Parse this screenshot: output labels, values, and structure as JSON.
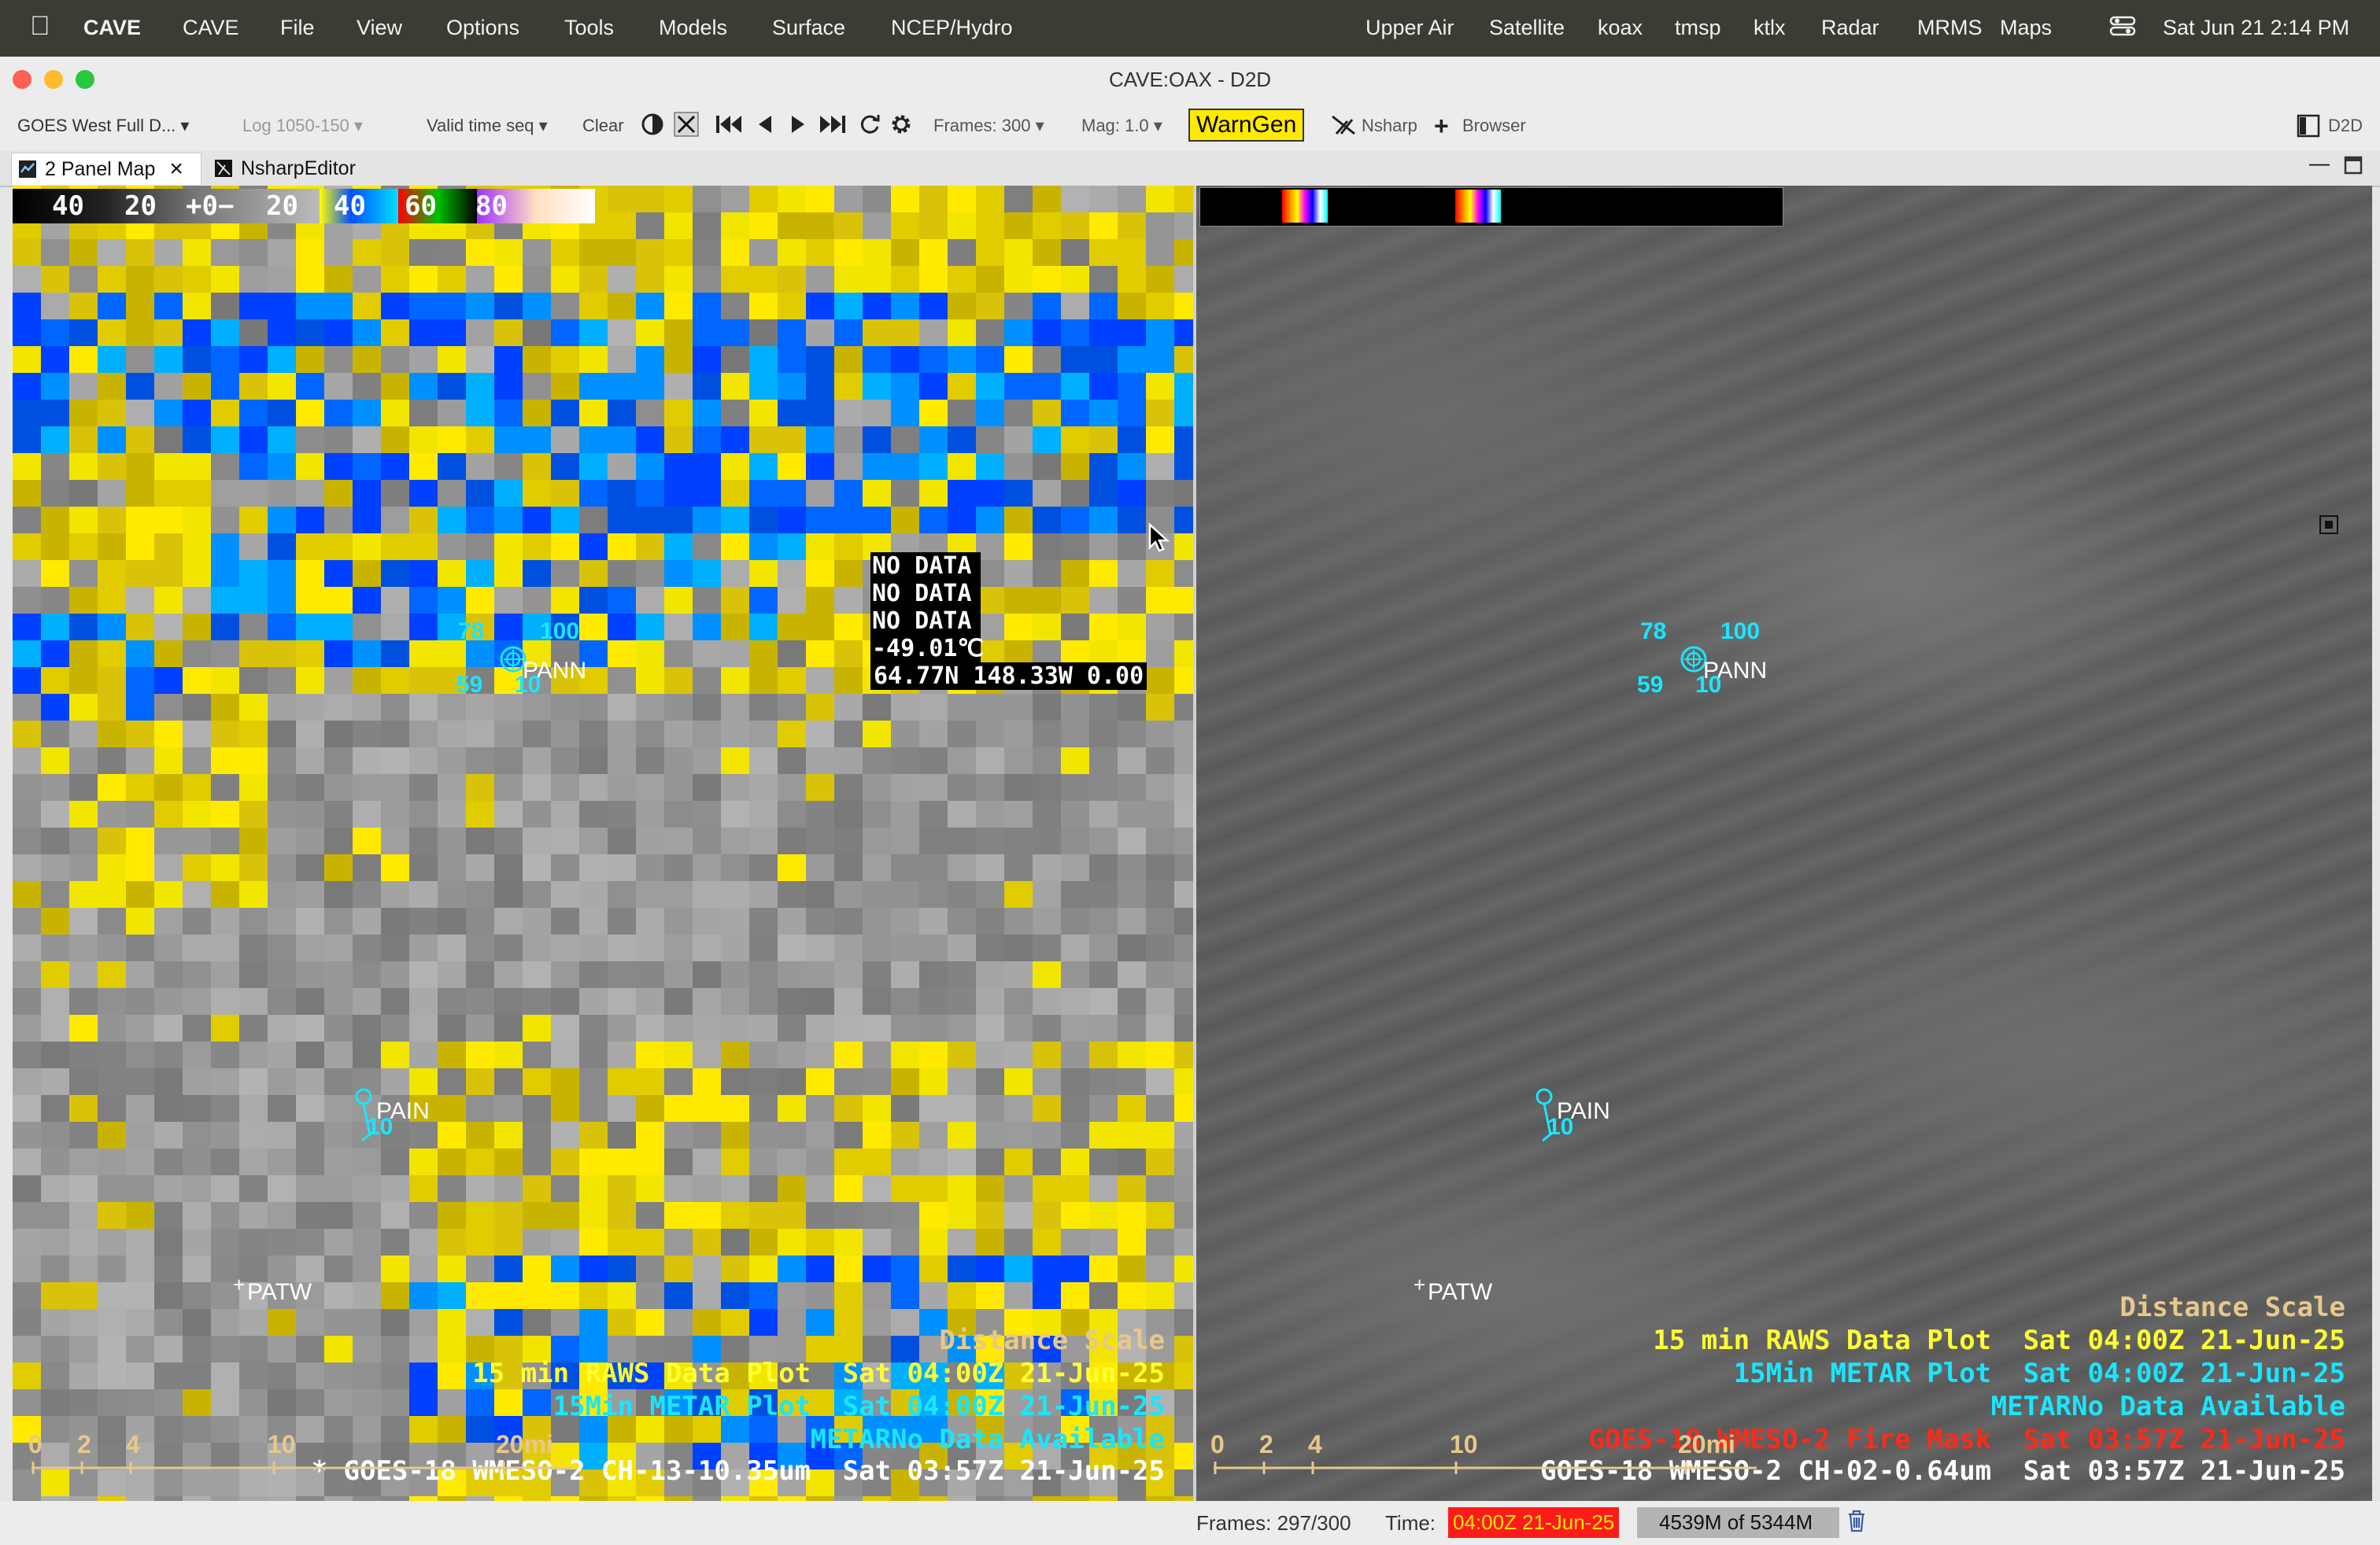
{
  "menubar": {
    "items": [
      "CAVE",
      "CAVE",
      "File",
      "View",
      "Options",
      "Tools",
      "Models",
      "Surface",
      "NCEP/Hydro"
    ],
    "right_items": [
      "Upper Air",
      "Satellite",
      "koax",
      "tmsp",
      "ktlx",
      "Radar",
      "MRMS",
      "Maps"
    ],
    "datetime": "Sat Jun 21  2:14 PM"
  },
  "window": {
    "title": "CAVE:OAX - D2D"
  },
  "toolbar": {
    "product": "GOES West Full D...",
    "log": "Log 1050-150",
    "valid_time": "Valid time seq",
    "clear": "Clear",
    "frames": "Frames: 300",
    "mag": "Mag: 1.0",
    "warngen": "WarnGen",
    "nsharp": "Nsharp",
    "browser": "Browser",
    "perspective": "D2D"
  },
  "tabs": [
    {
      "label": "2 Panel Map",
      "active": true
    },
    {
      "label": "NsharpEditor",
      "active": false
    }
  ],
  "left_panel": {
    "colorbar_labels": [
      "40",
      "20",
      "+0−",
      "20",
      "40",
      "60",
      "80"
    ],
    "sample_readout": [
      "NO DATA",
      "NO DATA",
      "NO DATA",
      "-49.01℃",
      "64.77N 148.33W 0.00"
    ],
    "stations": [
      {
        "id": "PANN",
        "temp": "78",
        "rh": "100",
        "dew": "59",
        "wind": "10"
      },
      {
        "id": "PAIN",
        "wind": "10"
      },
      {
        "id": "PATW"
      }
    ],
    "legend": [
      {
        "name": "Distance Scale",
        "time": "",
        "color": "#e8c88a"
      },
      {
        "name": "15 min RAWS Data Plot",
        "time": "Sat 04:00Z 21-Jun-25",
        "color": "#ffff33"
      },
      {
        "name": "15Min METAR Plot",
        "time": "Sat 04:00Z 21-Jun-25",
        "color": "#19e6ff"
      },
      {
        "name": "METARNo Data Available",
        "time": "",
        "color": "#19e6ff"
      },
      {
        "name": "* GOES-18 WMESO-2 CH-13-10.35um",
        "time": "Sat 03:57Z 21-Jun-25",
        "color": "#ffffff"
      }
    ],
    "scale_labels": [
      "0",
      "2",
      "4",
      "10",
      "20mi"
    ]
  },
  "right_panel": {
    "stations": [
      {
        "id": "PANN",
        "temp": "78",
        "rh": "100",
        "dew": "59",
        "wind": "10"
      },
      {
        "id": "PAIN",
        "wind": "10"
      },
      {
        "id": "PATW"
      }
    ],
    "legend": [
      {
        "name": "Distance Scale",
        "time": "",
        "color": "#e8c88a"
      },
      {
        "name": "15 min RAWS Data Plot",
        "time": "Sat 04:00Z 21-Jun-25",
        "color": "#ffff33"
      },
      {
        "name": "15Min METAR Plot",
        "time": "Sat 04:00Z 21-Jun-25",
        "color": "#19e6ff"
      },
      {
        "name": "METARNo Data Available",
        "time": "",
        "color": "#19e6ff"
      },
      {
        "name": "GOES-18 WMESO-2 Fire Mask",
        "time": "Sat 03:57Z 21-Jun-25",
        "color": "#ff2a1a"
      },
      {
        "name": "GOES-18 WMESO-2 CH-02-0.64um",
        "time": "Sat 03:57Z 21-Jun-25",
        "color": "#ffffff"
      }
    ],
    "scale_labels": [
      "0",
      "2",
      "4",
      "10",
      "20mi"
    ]
  },
  "statusbar": {
    "frames": "Frames:   297/300",
    "time_label": "Time:",
    "time_value": "04:00Z 21-Jun-25",
    "memory": "4539M of 5344M"
  }
}
